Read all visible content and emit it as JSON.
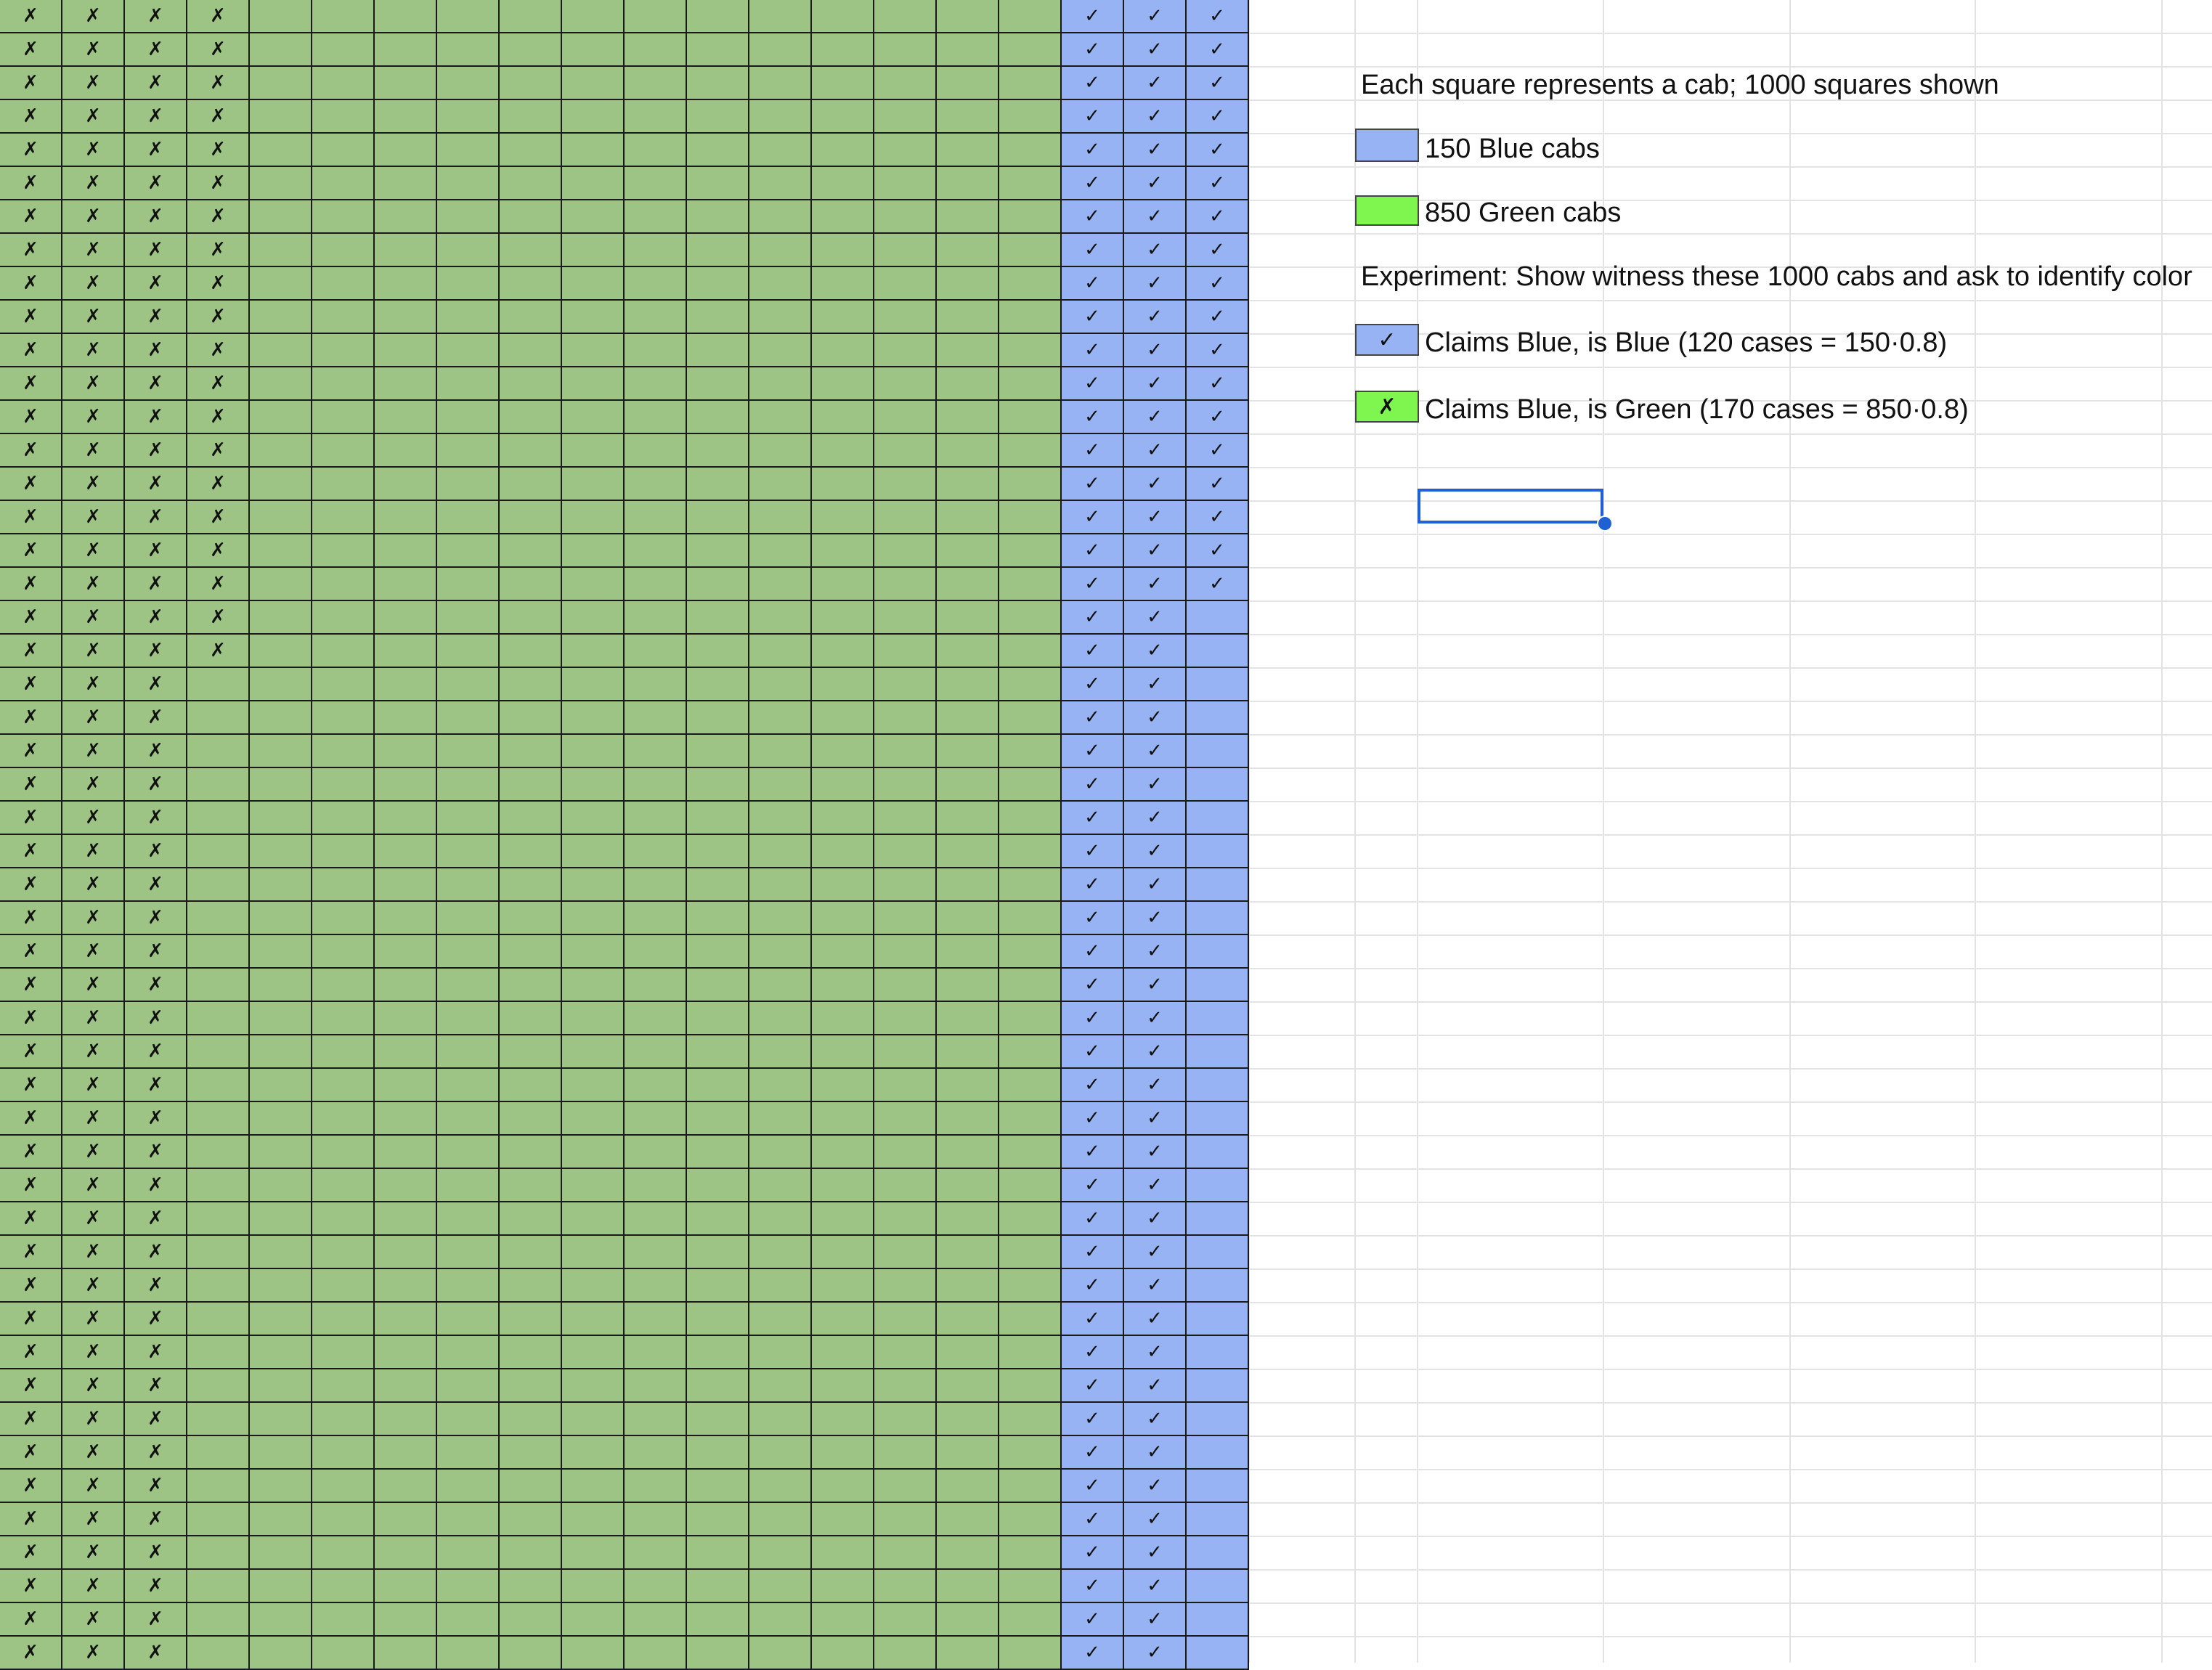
{
  "grid": {
    "total_squares": 1000,
    "colors": {
      "green": "#9dc484",
      "blue": "#97b3f3",
      "gridline": "#1a1a1a",
      "sheet_line": "#e3e3e3"
    },
    "check_mark": "✓",
    "x_mark": "✗"
  },
  "legend": {
    "caption": "Each square represents a cab; 1000 squares shown",
    "blue_label": "150 Blue cabs",
    "blue_color": "#97b3f3",
    "green_label": "850 Green cabs",
    "green_color": "#7ff550",
    "experiment": "Experiment: Show witness these 1000 cabs and ask to identify color",
    "claim_blue_symbol": "✓",
    "claim_blue_label": "Claims Blue, is Blue (120 cases = 150·0.8)",
    "claim_green_symbol": "✗",
    "claim_green_label": "Claims Blue, is Green (170 cases = 850·0.8)"
  },
  "selection": {
    "color": "#1f61d2"
  }
}
